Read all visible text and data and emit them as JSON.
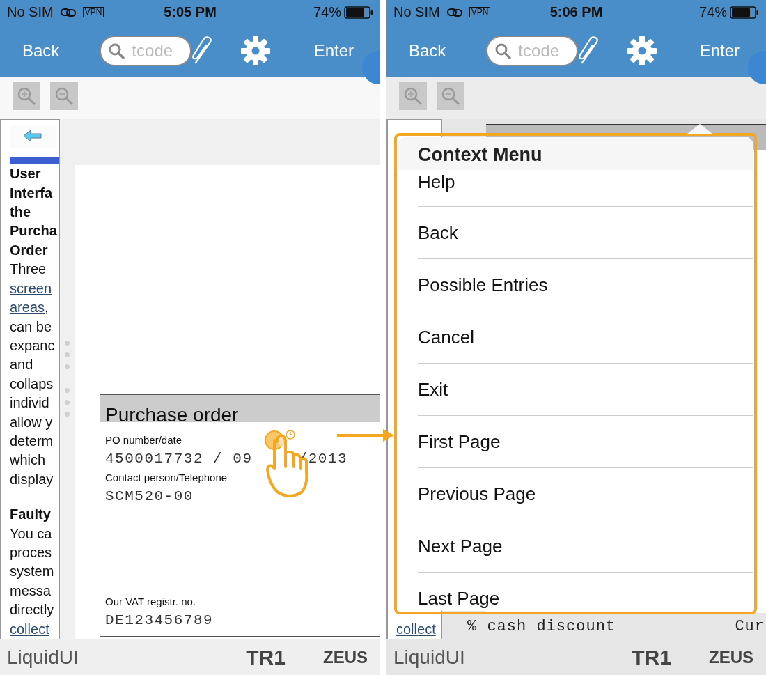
{
  "screens": [
    {
      "status_bar": {
        "carrier": "No SIM",
        "vpn": "VPN",
        "time": "5:05 PM",
        "battery": "74%"
      },
      "nav_bar": {
        "back": "Back",
        "search_placeholder": "tcode",
        "enter": "Enter"
      },
      "help_panel": {
        "sections": [
          {
            "heading": [
              "User",
              "Interfa",
              "the",
              "Purcha",
              "Order"
            ],
            "lines": [
              {
                "text": "Three",
                "kind": "text"
              },
              {
                "text": "screen",
                "kind": "link"
              },
              {
                "text": "areas",
                "kind": "link",
                "after": ","
              },
              {
                "text": "can be",
                "kind": "text"
              },
              {
                "text": "expanc",
                "kind": "text"
              },
              {
                "text": "and",
                "kind": "text"
              },
              {
                "text": "collaps",
                "kind": "text"
              },
              {
                "text": "individ",
                "kind": "text"
              },
              {
                "text": "allow y",
                "kind": "text"
              },
              {
                "text": "determ",
                "kind": "text"
              },
              {
                "text": "which",
                "kind": "text"
              },
              {
                "text": "display",
                "kind": "text"
              }
            ]
          },
          {
            "heading": [
              "Faulty"
            ],
            "lines": [
              {
                "text": "You ca",
                "kind": "text"
              },
              {
                "text": "proces",
                "kind": "text"
              },
              {
                "text": "system",
                "kind": "text"
              },
              {
                "text": "messa",
                "kind": "text"
              },
              {
                "text": "directly",
                "kind": "text"
              },
              {
                "text": "collect",
                "kind": "link"
              }
            ]
          }
        ]
      },
      "document": {
        "form": {
          "title": "Purchase order",
          "fields": [
            {
              "label": "PO number/date",
              "value": "4500017732 / 09",
              "value_end": "/2013"
            },
            {
              "label": "Contact person/Telephone",
              "value": "SCM520-00"
            },
            {
              "label": "Our VAT registr. no.",
              "value": "DE123456789"
            }
          ]
        }
      },
      "footer": {
        "brand": "LiquidUI",
        "system": "TR1",
        "server": "ZEUS"
      }
    },
    {
      "status_bar": {
        "carrier": "No SIM",
        "vpn": "VPN",
        "time": "5:06 PM",
        "battery": "74%"
      },
      "nav_bar": {
        "back": "Back",
        "search_placeholder": "tcode",
        "enter": "Enter"
      },
      "help_panel": {
        "sections": [
          {
            "lines": [
              {
                "text": "collect",
                "kind": "link"
              }
            ]
          }
        ]
      },
      "document": {
        "bottom_row": {
          "label": "% cash discount",
          "column_2": "Cur"
        }
      },
      "context_menu": {
        "title": "Context Menu",
        "items": [
          "Help",
          "Back",
          "Possible Entries",
          "Cancel",
          "Exit",
          "First Page",
          "Previous Page",
          "Next Page",
          "Last Page"
        ]
      },
      "footer": {
        "brand": "LiquidUI",
        "system": "TR1",
        "server": "ZEUS"
      }
    }
  ]
}
